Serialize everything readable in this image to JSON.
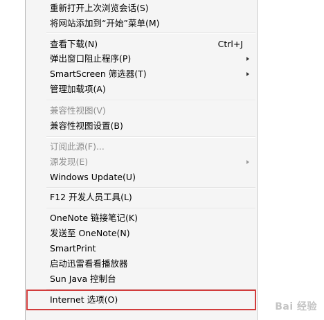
{
  "menu": {
    "items": [
      {
        "label": "重新打开上次浏览会话(S)"
      },
      {
        "label": "将网站添加到“开始”菜单(M)"
      },
      {
        "label": "查看下载(N)",
        "shortcut": "Ctrl+J"
      },
      {
        "label": "弹出窗口阻止程序(P)",
        "submenu": true
      },
      {
        "label": "SmartScreen 筛选器(T)",
        "submenu": true
      },
      {
        "label": "管理加载项(A)"
      },
      {
        "label": "兼容性视图(V)",
        "disabled": true
      },
      {
        "label": "兼容性视图设置(B)"
      },
      {
        "label": "订阅此源(F)...",
        "disabled": true
      },
      {
        "label": "源发现(E)",
        "disabled": true,
        "submenu": true
      },
      {
        "label": "Windows Update(U)"
      },
      {
        "label": "F12 开发人员工具(L)"
      },
      {
        "label": "OneNote 链接笔记(K)"
      },
      {
        "label": "发送至 OneNote(N)"
      },
      {
        "label": "SmartPrint"
      },
      {
        "label": "启动迅雷看看播放器"
      },
      {
        "label": "Sun Java 控制台"
      },
      {
        "label": "Internet 选项(O)"
      }
    ]
  },
  "highlight_color": "#d23c3c"
}
